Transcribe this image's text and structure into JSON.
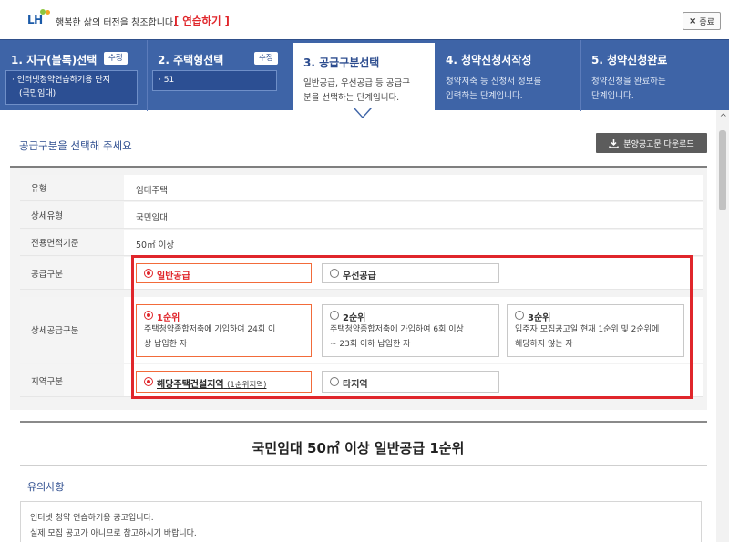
{
  "header": {
    "logo_text": "LH",
    "slogan": "행복한 삶의 터전을 창조합니다.",
    "practice_label": "[ 연습하기 ]",
    "close_label": "종료"
  },
  "steps": [
    {
      "title": "1. 지구(블록)선택",
      "edit_label": "수정",
      "info_lines": [
        "· 인터넷청약연습하기용 단지",
        "  (국민임대)"
      ]
    },
    {
      "title": "2. 주택형선택",
      "edit_label": "수정",
      "info_lines": [
        "· 51"
      ]
    },
    {
      "title": "3. 공급구분선택",
      "desc_lines": [
        "일반공급, 우선공급 등 공급구",
        "분을 선택하는 단계입니다."
      ]
    },
    {
      "title": "4. 청약신청서작성",
      "desc_lines": [
        "청약저축 등 신청서 정보를",
        "입력하는 단계입니다."
      ]
    },
    {
      "title": "5. 청약신청완료",
      "desc_lines": [
        "청약신청을 완료하는",
        "단계입니다."
      ]
    }
  ],
  "main": {
    "section_title": "공급구분을 선택해 주세요",
    "download_label": "분양공고문 다운로드",
    "info_rows": [
      {
        "label": "유형",
        "value": "임대주택"
      },
      {
        "label": "상세유형",
        "value": "국민임대"
      },
      {
        "label": "전용면적기준",
        "value": "50㎡ 이상"
      }
    ],
    "supply": {
      "label": "공급구분",
      "options": [
        {
          "title": "일반공급",
          "selected": true
        },
        {
          "title": "우선공급",
          "selected": false
        }
      ]
    },
    "detail_supply": {
      "label": "상세공급구분",
      "options": [
        {
          "title": "1순위",
          "selected": true,
          "desc_lines": [
            "주택청약종합저축에 가입하여 24회 이",
            "상 납입한 자"
          ]
        },
        {
          "title": "2순위",
          "selected": false,
          "desc_lines": [
            "주택청약종합저축에 가입하여 6회 이상",
            "~ 23회 이하 납입한 자"
          ]
        },
        {
          "title": "3순위",
          "selected": false,
          "desc_lines": [
            "입주자 모집공고일 현재 1순위 및 2순위에",
            "해당하지 않는 자"
          ]
        }
      ]
    },
    "region": {
      "label": "지역구분",
      "options": [
        {
          "title": "해당주택건설지역",
          "sub": "(1순위지역)",
          "selected": true
        },
        {
          "title": "타지역",
          "selected": false
        }
      ]
    },
    "result_title": "국민임대 50㎡ 이상 일반공급 1순위",
    "notice": {
      "title": "유의사항",
      "lines": [
        "인터넷 청약 연습하기용 공고입니다.",
        "실제 모집 공고가 아니므로 참고하시기 바랍니다."
      ]
    }
  }
}
